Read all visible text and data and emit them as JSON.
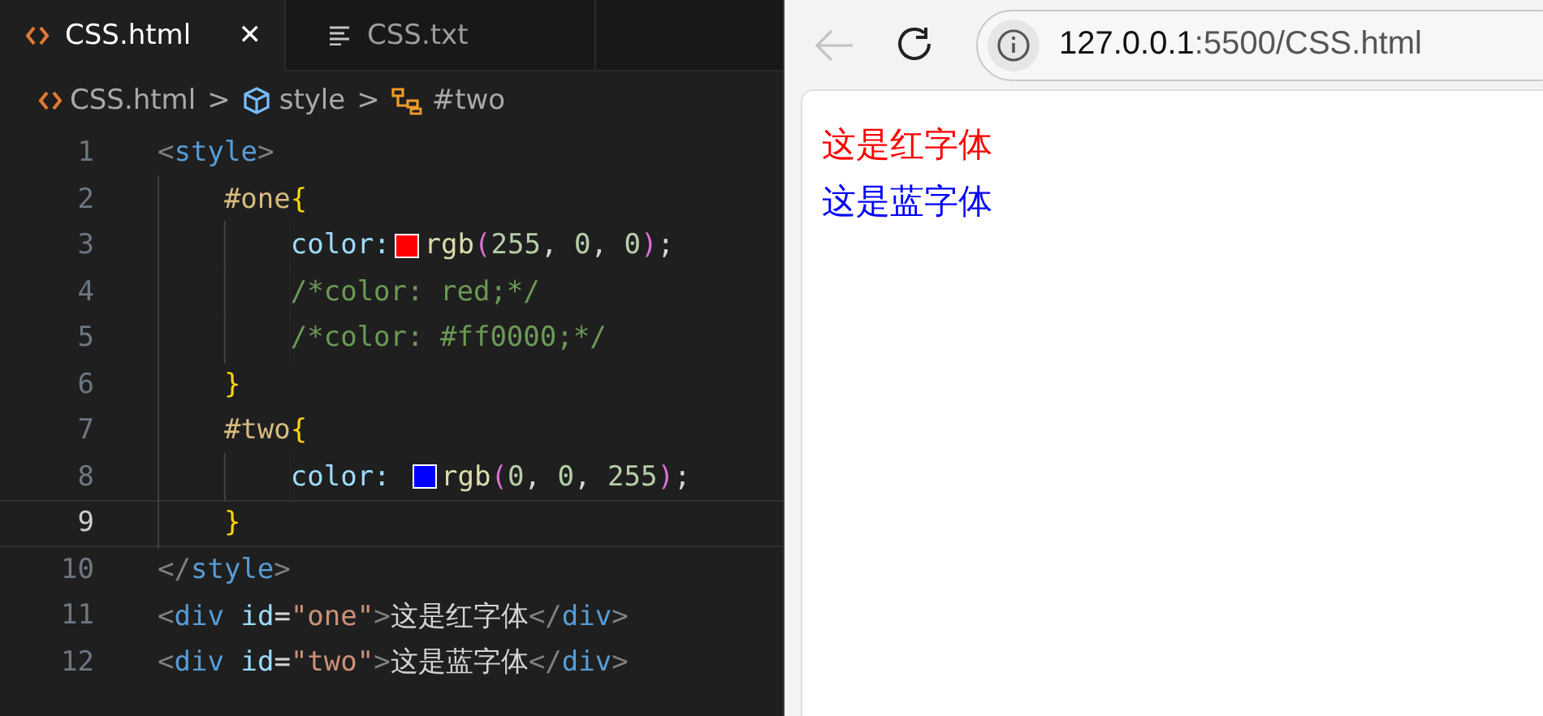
{
  "editor": {
    "tabs": [
      {
        "label": "CSS.html",
        "kind": "html",
        "selected": true,
        "close": "✕"
      },
      {
        "label": "CSS.txt",
        "kind": "text",
        "selected": false
      }
    ],
    "breadcrumbs": [
      {
        "label": "CSS.html",
        "kind": "file"
      },
      {
        "label": "style",
        "kind": "element"
      },
      {
        "label": "#two",
        "kind": "selector"
      }
    ],
    "breadcrumb_separator": ">",
    "lines": [
      {
        "number": "1",
        "active": false,
        "segments": [
          {
            "kind": "code",
            "tokens": [
              {
                "t": "<",
                "kind": "punct"
              },
              {
                "t": "style",
                "kind": "tag"
              },
              {
                "t": ">",
                "kind": "punct"
              }
            ]
          }
        ]
      },
      {
        "number": "2",
        "active": false,
        "segments": [
          {
            "kind": "code",
            "tokens": [
              {
                "t": "    #one",
                "kind": "selector"
              },
              {
                "t": "{",
                "kind": "brace"
              }
            ]
          }
        ]
      },
      {
        "number": "3",
        "active": false,
        "segments": [
          {
            "kind": "code",
            "tokens": [
              {
                "t": "        color:",
                "kind": "prop"
              }
            ]
          },
          {
            "kind": "swatch",
            "color": "#ff0000"
          },
          {
            "kind": "code",
            "tokens": [
              {
                "t": "rgb",
                "kind": "func"
              },
              {
                "t": "(",
                "kind": "paren"
              },
              {
                "t": "255",
                "kind": "number"
              },
              {
                "t": ", ",
                "kind": "text"
              },
              {
                "t": "0",
                "kind": "number"
              },
              {
                "t": ", ",
                "kind": "text"
              },
              {
                "t": "0",
                "kind": "number"
              },
              {
                "t": ")",
                "kind": "paren"
              },
              {
                "t": ";",
                "kind": "text"
              }
            ]
          }
        ]
      },
      {
        "number": "4",
        "active": false,
        "segments": [
          {
            "kind": "code",
            "tokens": [
              {
                "t": "        /*color: red;*/",
                "kind": "comment"
              }
            ]
          }
        ]
      },
      {
        "number": "5",
        "active": false,
        "segments": [
          {
            "kind": "code",
            "tokens": [
              {
                "t": "        /*color: #ff0000;*/",
                "kind": "comment"
              }
            ]
          }
        ]
      },
      {
        "number": "6",
        "active": false,
        "segments": [
          {
            "kind": "code",
            "tokens": [
              {
                "t": "    }",
                "kind": "brace"
              }
            ]
          }
        ]
      },
      {
        "number": "7",
        "active": false,
        "segments": [
          {
            "kind": "code",
            "tokens": [
              {
                "t": "    #two",
                "kind": "selector"
              },
              {
                "t": "{",
                "kind": "brace"
              }
            ]
          }
        ]
      },
      {
        "number": "8",
        "active": false,
        "segments": [
          {
            "kind": "code",
            "tokens": [
              {
                "t": "        color: ",
                "kind": "prop"
              }
            ]
          },
          {
            "kind": "swatch",
            "color": "#0000ff"
          },
          {
            "kind": "code",
            "tokens": [
              {
                "t": "rgb",
                "kind": "func"
              },
              {
                "t": "(",
                "kind": "paren"
              },
              {
                "t": "0",
                "kind": "number"
              },
              {
                "t": ", ",
                "kind": "text"
              },
              {
                "t": "0",
                "kind": "number"
              },
              {
                "t": ", ",
                "kind": "text"
              },
              {
                "t": "255",
                "kind": "number"
              },
              {
                "t": ")",
                "kind": "paren"
              },
              {
                "t": ";",
                "kind": "text"
              }
            ]
          }
        ]
      },
      {
        "number": "9",
        "active": true,
        "segments": [
          {
            "kind": "code",
            "tokens": [
              {
                "t": "    }",
                "kind": "brace"
              }
            ]
          }
        ]
      },
      {
        "number": "10",
        "active": false,
        "segments": [
          {
            "kind": "code",
            "tokens": [
              {
                "t": "</",
                "kind": "punct"
              },
              {
                "t": "style",
                "kind": "tag"
              },
              {
                "t": ">",
                "kind": "punct"
              }
            ]
          }
        ]
      },
      {
        "number": "11",
        "active": false,
        "segments": [
          {
            "kind": "code",
            "tokens": [
              {
                "t": "<",
                "kind": "punct"
              },
              {
                "t": "div",
                "kind": "tag"
              },
              {
                "t": " id",
                "kind": "attr"
              },
              {
                "t": "=",
                "kind": "text"
              },
              {
                "t": "\"one\"",
                "kind": "string"
              },
              {
                "t": ">",
                "kind": "punct"
              },
              {
                "t": "这是红字体",
                "kind": "text"
              },
              {
                "t": "</",
                "kind": "punct"
              },
              {
                "t": "div",
                "kind": "tag"
              },
              {
                "t": ">",
                "kind": "punct"
              }
            ]
          }
        ]
      },
      {
        "number": "12",
        "active": false,
        "segments": [
          {
            "kind": "code",
            "tokens": [
              {
                "t": "<",
                "kind": "punct"
              },
              {
                "t": "div",
                "kind": "tag"
              },
              {
                "t": " id",
                "kind": "attr"
              },
              {
                "t": "=",
                "kind": "text"
              },
              {
                "t": "\"two\"",
                "kind": "string"
              },
              {
                "t": ">",
                "kind": "punct"
              },
              {
                "t": "这是蓝字体",
                "kind": "text"
              },
              {
                "t": "</",
                "kind": "punct"
              },
              {
                "t": "div",
                "kind": "tag"
              },
              {
                "t": ">",
                "kind": "punct"
              }
            ]
          }
        ]
      }
    ]
  },
  "browser": {
    "back_disabled": true,
    "url": {
      "host": "127.0.0.1",
      "rest": ":5500/CSS.html"
    },
    "page": [
      {
        "text": "这是红字体",
        "color": "#ff0000"
      },
      {
        "text": "这是蓝字体",
        "color": "#0000ff"
      }
    ]
  }
}
